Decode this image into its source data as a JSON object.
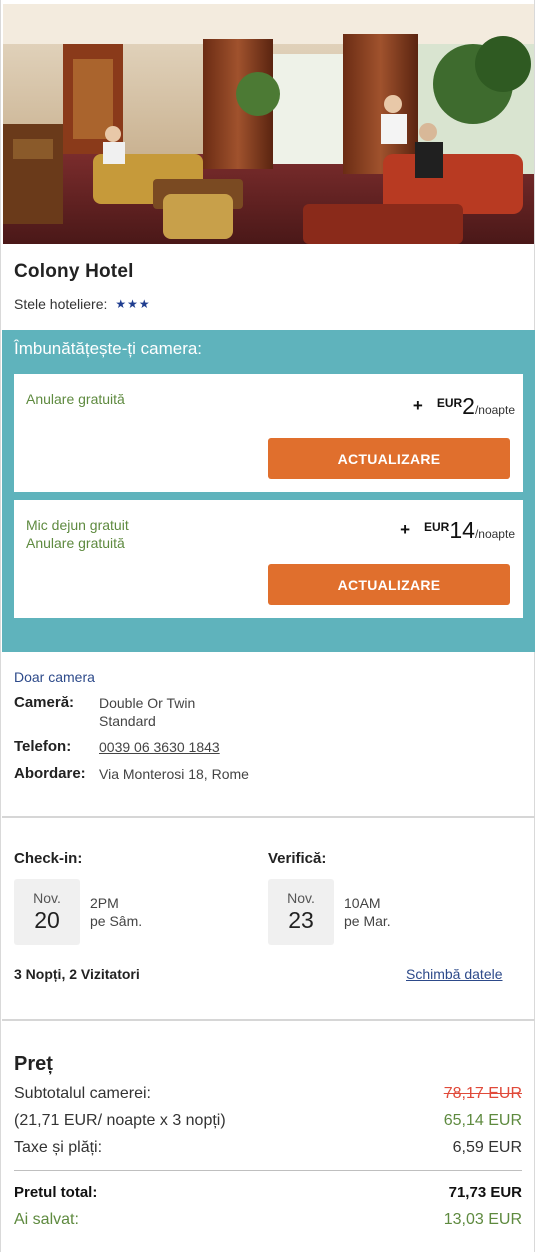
{
  "hotel": {
    "name": "Colony Hotel",
    "stars_label": "Stele hoteliere:",
    "stars": "★★★"
  },
  "upgrade": {
    "title": "Îmbunătățește-ți camera:",
    "options": [
      {
        "lines": [
          "Anulare gratuită"
        ],
        "plus": "+",
        "currency": "EUR",
        "amount": "2",
        "per": "/noapte",
        "button": "ACTUALIZARE"
      },
      {
        "lines": [
          "Mic dejun gratuit",
          "Anulare gratuită"
        ],
        "plus": "+",
        "currency": "EUR",
        "amount": "14",
        "per": "/noapte",
        "button": "ACTUALIZARE"
      }
    ]
  },
  "details": {
    "room_only": "Doar camera",
    "room_label": "Cameră:",
    "room_value_1": "Double Or Twin",
    "room_value_2": "Standard",
    "phone_label": "Telefon:",
    "phone_value": "0039 06 3630 1843",
    "address_label": "Abordare:",
    "address_value": "Via Monterosi 18, Rome"
  },
  "stay": {
    "checkin_label": "Check-in:",
    "checkin_month": "Nov.",
    "checkin_day": "20",
    "checkin_time": "2PM",
    "checkin_weekday": "pe Sâm.",
    "checkout_label": "Verifică:",
    "checkout_month": "Nov.",
    "checkout_day": "23",
    "checkout_time": "10AM",
    "checkout_weekday": "pe Mar.",
    "summary": "3 Nopți, 2 Vizitatori",
    "change_link": "Schimbă datele"
  },
  "pricing": {
    "title": "Preț",
    "subtotal_label": "Subtotalul camerei:",
    "subtotal_old": "78,17 EUR",
    "per_night_label": "(21,71 EUR/ noapte x 3 nopți)",
    "per_night_value": "65,14 EUR",
    "taxes_label": "Taxe și plăți:",
    "taxes_value": "6,59 EUR",
    "total_label": "Pretul total:",
    "total_value": "71,73 EUR",
    "saved_label": "Ai salvat:",
    "saved_value": "13,03 EUR"
  },
  "colors": {
    "teal": "#5fb3bc",
    "orange": "#e06f2d",
    "green": "#5e8a3f",
    "link_blue": "#2d4a8a",
    "strike_red": "#e04a3a"
  }
}
